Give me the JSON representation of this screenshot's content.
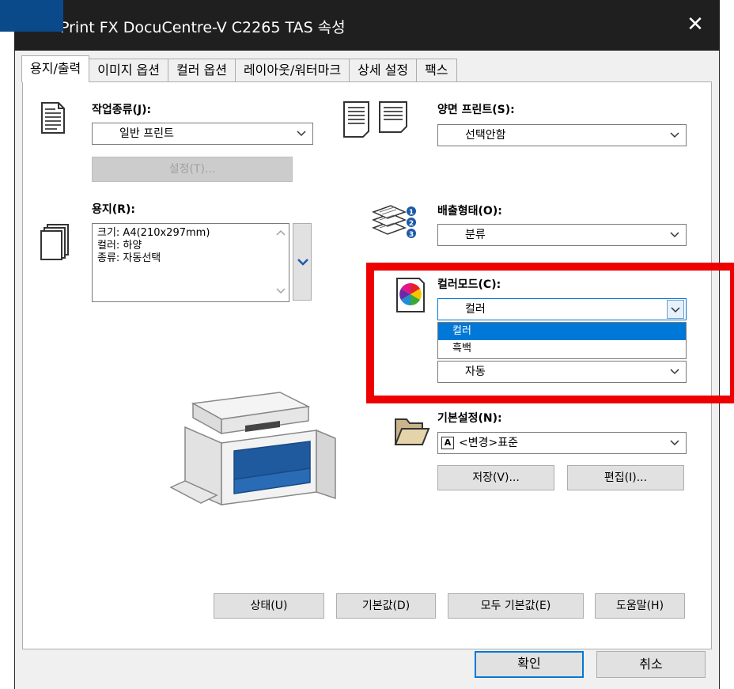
{
  "window": {
    "title": "Print FX DocuCentre-V C2265 TAS 속성",
    "close_glyph": "✕"
  },
  "tabs": [
    {
      "label": "용지/출력",
      "active": true
    },
    {
      "label": "이미지 옵션"
    },
    {
      "label": "컬러 옵션"
    },
    {
      "label": "레이아웃/워터마크"
    },
    {
      "label": "상세 설정"
    },
    {
      "label": "팩스"
    }
  ],
  "job_type": {
    "label": "작업종류(J):",
    "value": "일반 프린트",
    "settings_button": "설정(T)..."
  },
  "duplex": {
    "label": "양면 프린트(S):",
    "value": "선택안함"
  },
  "paper": {
    "label": "용지(R):",
    "lines": [
      "크기: A4(210x297mm)",
      "컬러: 하양",
      "종류: 자동선택"
    ]
  },
  "output": {
    "label": "배출형태(O):",
    "value": "분류"
  },
  "color_mode": {
    "label": "컬러모드(C):",
    "value": "컬러",
    "options": [
      {
        "label": "컬러",
        "selected": true
      },
      {
        "label": "흑백"
      }
    ]
  },
  "hidden_combo": {
    "value": "자동"
  },
  "preset": {
    "label": "기본설정(N):",
    "badge": "A",
    "value": "<변경>표준",
    "save_button": "저장(V)...",
    "edit_button": "편집(I)..."
  },
  "bottom_buttons": {
    "status": "상태(U)",
    "defaults": "기본값(D)",
    "all_defaults": "모두 기본값(E)",
    "help": "도움말(H)"
  },
  "dialog_buttons": {
    "ok": "확인",
    "cancel": "취소"
  },
  "colors": {
    "accent": "#0078d7",
    "highlight": "#ee0000",
    "titlebar": "#1f1f1f"
  }
}
